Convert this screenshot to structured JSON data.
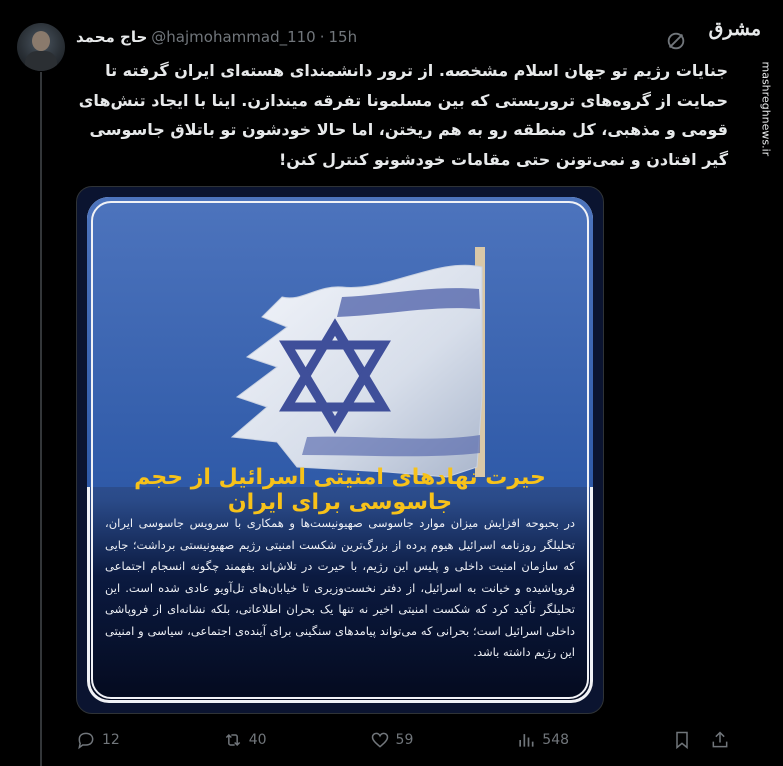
{
  "author": {
    "display_name": "حاج محمد",
    "handle": "@hajmohammad_110",
    "separator": "·",
    "time": "15h"
  },
  "watermark": {
    "logo_text": "مشرق",
    "side_text": "mashreghnews.ir"
  },
  "tweet": {
    "text": "جنایات رژیم تو جهان اسلام مشخصه. از ترور دانشمندای هسته‌ای ایران گرفته تا حمایت از گروه‌های تروریستی که بین مسلمونا تفرقه میندازن. اینا با ایجاد تنش‌های قومی و مذهبی، کل منطقه رو به هم ریختن، اما حالا خودشون تو باتلاق جاسوسی گیر افتادن و نمی‌تونن حتی مقامات خودشونو کنترل کنن!"
  },
  "media_card": {
    "headline": "حیرت نهادهای امنیتی اسرائیل از حجم جاسوسی برای ایران",
    "body": "در بحبوحه افزایش میزان موارد جاسوسی صهیونیست‌ها و همکاری با سرویس جاسوسی ایران، تحلیلگر روزنامه اسرائیل هیوم پرده از بزرگ‌ترین شکست امنیتی رژیم صهیونیستی برداشت؛ جایی که سازمان امنیت داخلی و پلیس این رژیم، با حیرت در تلاش‌اند بفهمند چگونه انسجام اجتماعی فروپاشیده و خیانت به اسرائیل، از دفتر نخست‌وزیری تا خیابان‌های تل‌آویو عادی شده است. این تحلیلگر تأکید کرد که شکست امنیتی اخیر نه تنها یک بحران اطلاعاتی، بلکه نشانه‌ای از فروپاشی داخلی اسرائیل است؛ بحرانی که می‌تواند پیامدهای سنگینی برای آینده‌ی اجتماعی، سیاسی و امنیتی این رژیم داشته باشد.",
    "headline_color": "#f7c21a"
  },
  "actions": {
    "replies": "12",
    "reposts": "40",
    "likes": "59",
    "views": "548"
  },
  "colors": {
    "background": "#000000",
    "text": "#e7e9ea",
    "muted": "#71767b",
    "divider": "#333639"
  }
}
